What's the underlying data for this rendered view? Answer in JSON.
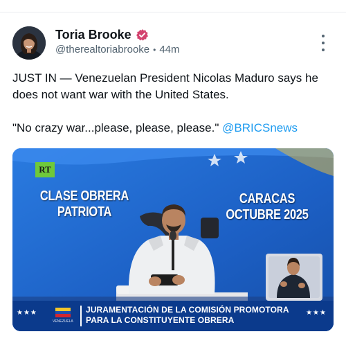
{
  "post": {
    "author": {
      "name": "Toria Brooke",
      "handle": "@therealtoriabrooke",
      "separator": "•",
      "time": "44m",
      "verified": true
    },
    "text": {
      "line1": "JUST IN — Venezuelan President Nicolas Maduro says he does not want war with the United States.",
      "quote": "\"No crazy war...please, please, please.\"",
      "mention": "@BRICSnews"
    },
    "media": {
      "channel_logo": "RT",
      "overlay_left": [
        "CLASE OBRERA",
        "PATRIOTA"
      ],
      "overlay_right": [
        "CARACAS",
        "OCTUBRE 2025"
      ],
      "banner_line1": "JURAMENTACIÓN DE LA COMISIÓN PROMOTORA",
      "banner_line2": "PARA LA CONSTITUYENTE OBRERA",
      "banner_stars_left": "★★★",
      "banner_stars_right": "★★★",
      "banner_sub": "VENEZUELA"
    }
  },
  "icons": {
    "verified": "verified-badge-icon",
    "more": "more-options-icon"
  },
  "colors": {
    "text": "#0f1419",
    "muted": "#536471",
    "link": "#1d9bf0",
    "verified": "#d3426e",
    "video_bg": "#1f6fd1",
    "banner": "#0b3a8c"
  }
}
